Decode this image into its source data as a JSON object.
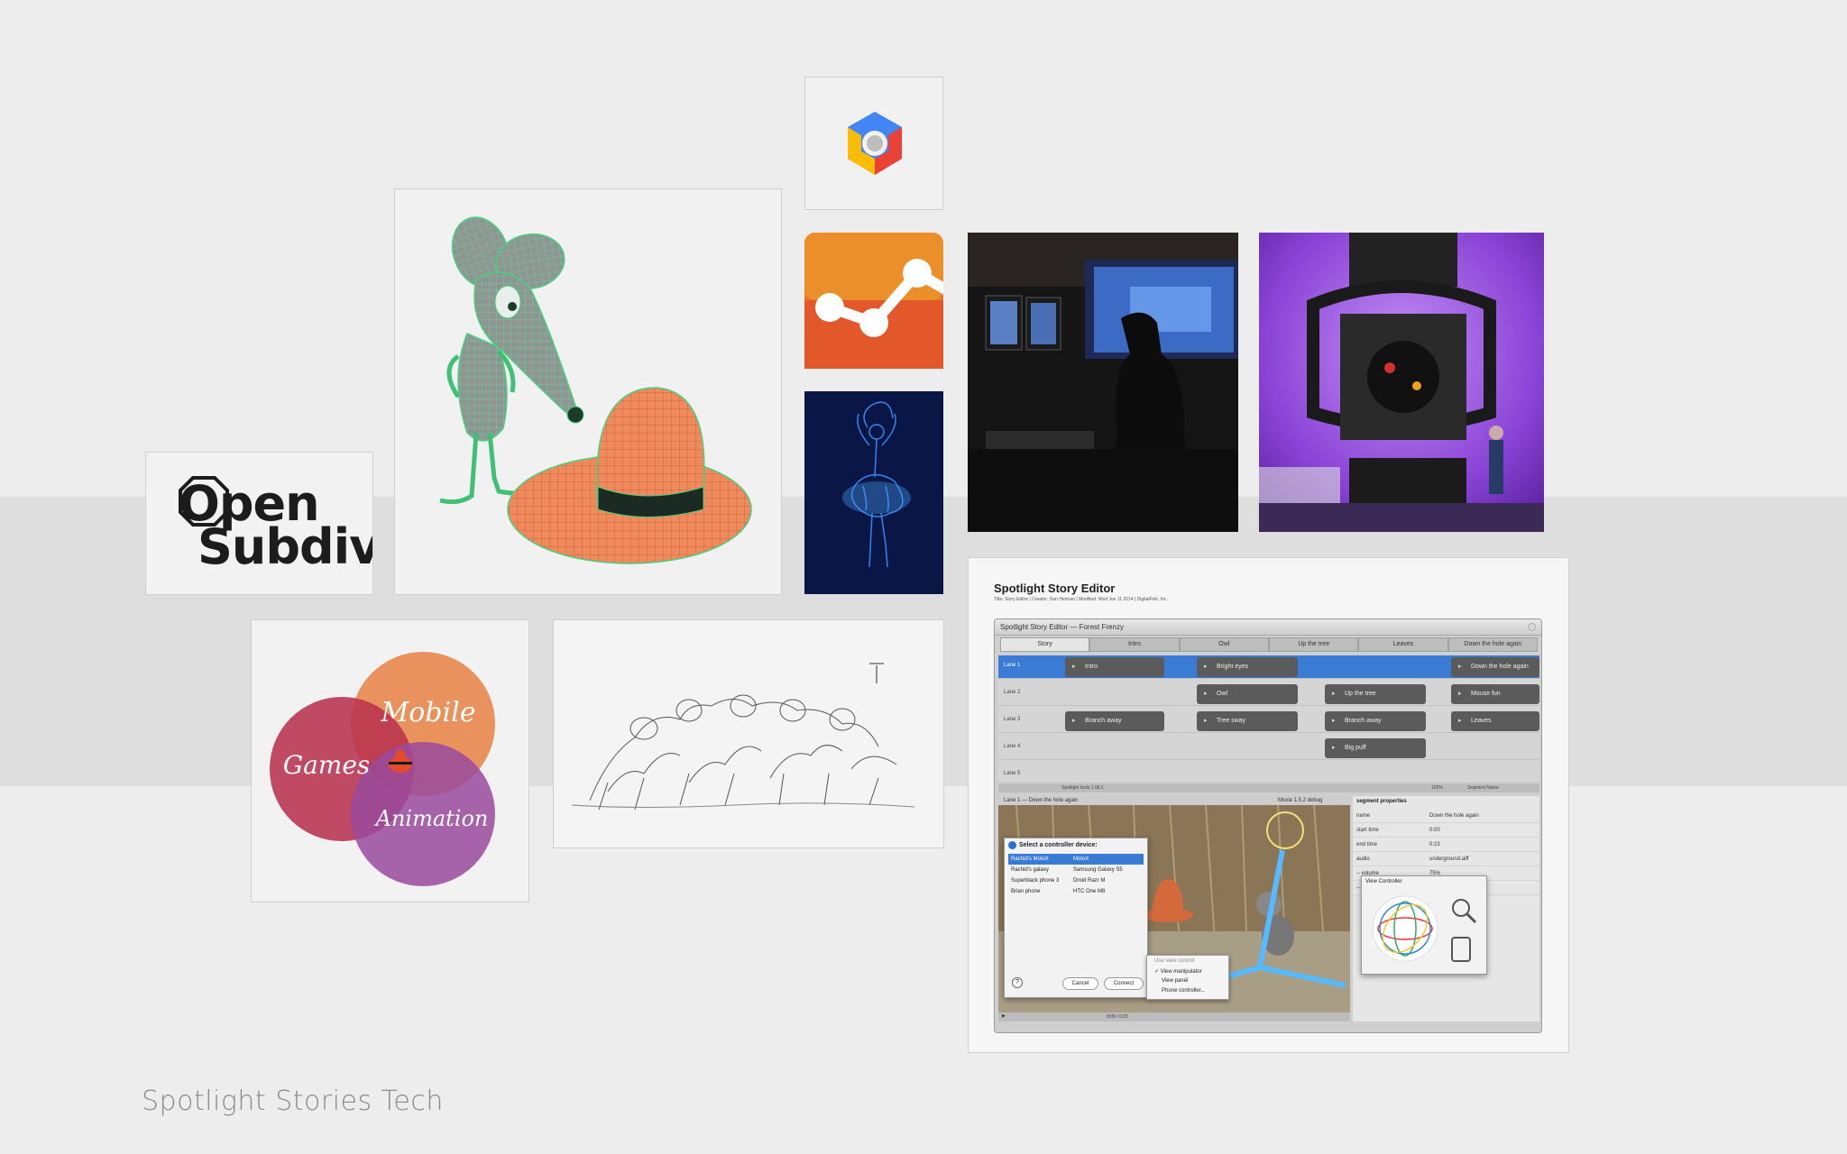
{
  "footer": {
    "title": "Spotlight Stories Tech"
  },
  "opensubdiv": {
    "line1": "Open",
    "line2": "Subdiv"
  },
  "venn": {
    "labels": [
      "Mobile",
      "Games",
      "Animation"
    ]
  },
  "colors": {
    "analytics": "#e9762a",
    "ballet_bg": "#0a1746",
    "photo_purple": "#6a2fb2",
    "venn_orange": "#e8874e",
    "venn_red": "#b8324f",
    "venn_purple": "#9a4a9e"
  },
  "icons": [
    "google-cloud-icon",
    "google-analytics-icon"
  ],
  "editor": {
    "title": "Spotlight Story Editor",
    "subtitle": "Title: Story Editor  |  Creator: Dan Herman  |  Modified: Wed Jun 11 2014  |  DigitalFish, Inc.",
    "window_title": "Spotlight Story Editor — Forest Frenzy",
    "tabs": [
      "Story",
      "Intro",
      "Owl",
      "Up the tree",
      "Leaves",
      "Down the hole again"
    ],
    "lanes": [
      {
        "label": "Lane 1",
        "segments": [
          "Intro",
          "Bright eyes",
          "Down the hole again"
        ]
      },
      {
        "label": "Lane 2",
        "segments": [
          "Owl",
          "Up the tree",
          "Mouse fun"
        ]
      },
      {
        "label": "Lane 3",
        "segments": [
          "Branch away",
          "Tree sway",
          "Branch away",
          "Leaves"
        ]
      },
      {
        "label": "Lane 4",
        "segments": [
          "Big puff"
        ]
      },
      {
        "label": "Lane 5",
        "segments": []
      }
    ],
    "toolbar": {
      "left": "Spotlight tools 1.06.1",
      "zoom": "100%",
      "segment": "Segment Name"
    },
    "viewport": {
      "title": "Lane 1 — Down the hole again",
      "debug": "Moxie 1.5.2 debug",
      "time": "0:09 / 0:23"
    },
    "properties": {
      "header": "segment properties",
      "rows": [
        {
          "key": "name",
          "value": "Down the hole again"
        },
        {
          "key": "start time",
          "value": "0:00"
        },
        {
          "key": "end time",
          "value": "0:23"
        },
        {
          "key": "audio",
          "value": "underground.aiff"
        },
        {
          "key": "-- volume",
          "value": "75%"
        },
        {
          "key": "-- 3-D spatial",
          "value": "true"
        }
      ]
    },
    "device_dialog": {
      "title": "Select a controller device:",
      "devices": [
        {
          "name": "Rachid's MotoX",
          "model": "MotoX"
        },
        {
          "name": "Rachid's galaxy",
          "model": "Samsung Galaxy S5"
        },
        {
          "name": "Superblack phone 3",
          "model": "Droid Razr M"
        },
        {
          "name": "Brian phone",
          "model": "HTC One M8"
        }
      ],
      "help": "?",
      "cancel": "Cancel",
      "connect": "Connect"
    },
    "view_menu": {
      "header": "Use view control:",
      "items": [
        "View manipulator",
        "View panel",
        "Phone controller..."
      ],
      "checked": "View manipulator"
    },
    "view_controller": {
      "title": "View Controller"
    }
  }
}
